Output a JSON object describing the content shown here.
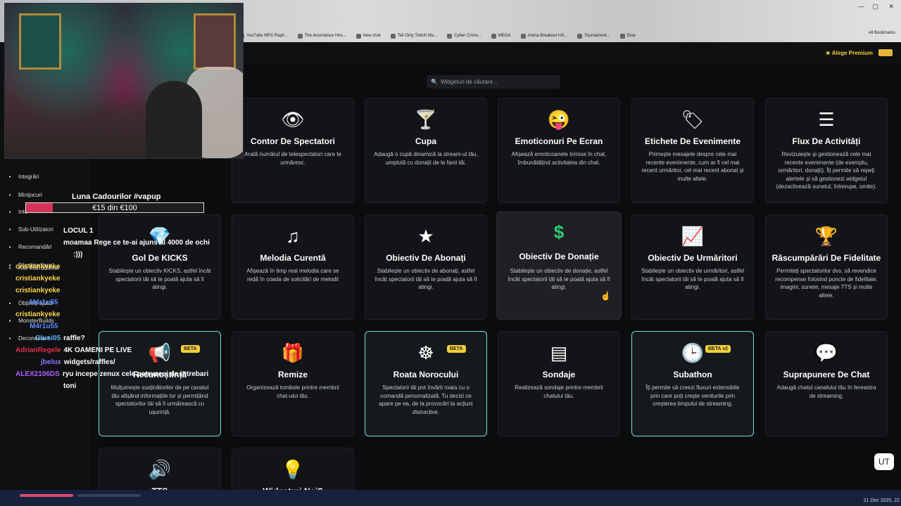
{
  "browser": {
    "bookmarks": [
      "YouTube MP3 Playli...",
      "The Anomalous Hos...",
      "New chat",
      "Tell Only Twitch Ma...",
      "Cyber Crime...",
      "MEGA",
      "Arena Breakout Infi...",
      "Tournament...",
      "Diva"
    ],
    "all_bookmarks": "All Bookmarks"
  },
  "header": {
    "premium_label": "Alege Premium"
  },
  "search": {
    "placeholder": "Widgeturi de căutare..."
  },
  "sidebar": {
    "items": [
      {
        "label": "Integrări",
        "icon": "integrations-icon"
      },
      {
        "label": "Minijocuri",
        "icon": "gamepad-icon"
      },
      {
        "label": "Inte",
        "icon": "music-icon"
      },
      {
        "label": "Sub-Utilizatori",
        "icon": "users-icon"
      },
      {
        "label": "Recomandări",
        "icon": "recommend-icon"
      },
      {
        "label": "Alte Instrumente",
        "icon": "tools-icon"
      },
      {
        "label": "Documentare",
        "icon": "docs-icon"
      },
      {
        "label": "Obțineți ajutor",
        "icon": "help-icon"
      },
      {
        "label": "MonsterBuilds",
        "icon": "monitor-icon"
      },
      {
        "label": "Deconectare",
        "icon": "logout-icon"
      }
    ]
  },
  "overlay": {
    "donation_title": "Luna Cadourilor #vapup",
    "donation_text": "€15 din €100",
    "donation_fraction": 0.15,
    "chat": [
      {
        "user": "",
        "msg": "LOCUL 1",
        "color": "#ffffff"
      },
      {
        "user": "",
        "msg": "moamaa Rege ce te-ai ajuns al 4000 de ochi",
        "color": "#ffffff"
      },
      {
        "user": "",
        "msg": ":)))",
        "color": "#ffffff"
      },
      {
        "user": "cristiankyeke",
        "msg": "",
        "color": "#ffd54a"
      },
      {
        "user": "cristiankyeke",
        "msg": "",
        "color": "#ffd54a"
      },
      {
        "user": "cristiankyeke",
        "msg": "",
        "color": "#ffd54a"
      },
      {
        "user": "M4r1u55",
        "msg": "",
        "color": "#5b8cff"
      },
      {
        "user": "cristiankyeke",
        "msg": "",
        "color": "#ffd54a"
      },
      {
        "user": "M4r1u55",
        "msg": "",
        "color": "#5b8cff"
      },
      {
        "user": "Glusi05",
        "msg": "raffle?",
        "color": "#5bb1ff"
      },
      {
        "user": "AdrianRegele",
        "msg": "4K OAMENI PE LIVE",
        "color": "#e0304a"
      },
      {
        "user": "jbelux",
        "msg": "widgets/raffles/",
        "color": "#8a78ff"
      },
      {
        "user": "ALEX2106DS",
        "msg": "ryu incepe zenux cele patruzeci de intrebari",
        "color": "#b05cff"
      },
      {
        "user": "",
        "msg": "toni",
        "color": "#ffffff"
      }
    ]
  },
  "cards": [
    {
      "title": "Contor De Spectatori",
      "desc": "Arată numărul de telespectatori care te urmăresc.",
      "icon": "eye-icon",
      "glyph": "👁"
    },
    {
      "title": "Cupa",
      "desc": "Adaugă o cupă dinamică la stream-ul tău, umplută cu donații de la fanii tăi.",
      "icon": "cocktail-icon",
      "glyph": "🍸"
    },
    {
      "title": "Emoticonuri Pe Ecran",
      "desc": "Afișează emoticoanele trimise în chat, îmbunătățind activitatea din chat.",
      "icon": "emoji-icon",
      "glyph": "😜"
    },
    {
      "title": "Etichete De Evenimente",
      "desc": "Primește mesajele despre cele mai recente evenimente, cum ar fi cel mai recent urmăritor, cel mai recent abonat și multe altele.",
      "icon": "tags-icon",
      "glyph": "🏷"
    },
    {
      "title": "Flux De Activități",
      "desc": "Revizuiește și gestionează cele mai recente evenimente (de exemplu, urmăritori, donații). Îți permite să repeți alertele și să gestionezi widgetul (dezactivează sunetul, întrerupe, omite).",
      "icon": "list-icon",
      "glyph": "☰"
    },
    {
      "title": "Gol De KICKS",
      "desc": "Stabilește un obiectiv KICKS, astfel încât spectatorii tăi să te poată ajuta să îl atingi.",
      "icon": "diamond-icon",
      "glyph": "💎"
    },
    {
      "title": "Melodia Curentă",
      "desc": "Afișează în timp real melodia care se redă în coada de solicitări de melodii",
      "icon": "music-note-icon",
      "glyph": "♫"
    },
    {
      "title": "Obiectiv De Abonați",
      "desc": "Stabilește un obiectiv de abonați, astfel încât spectatorii tăi să te poată ajuta să îl atingi.",
      "icon": "star-icon",
      "glyph": "★"
    },
    {
      "title": "Obiectiv De Donație",
      "desc": "Stabilește un obiectiv de donație, astfel încât spectatorii tăi să te poată ajuta să îl atingi.",
      "icon": "dollar-icon",
      "glyph": "$"
    },
    {
      "title": "Obiectiv De Urmăritori",
      "desc": "Stabilește un obiectiv de urmăritori, astfel încât spectatorii tăi să te poată ajuta să îl atingi.",
      "icon": "chart-icon",
      "glyph": "📈"
    },
    {
      "title": "Răscumpărări De Fidelitate",
      "desc": "Permiteți spectatorilor dvs. să revendice recompense folosind puncte de fidelitate: imagini, sunete, mesaje TTS și multe altele.",
      "icon": "trophy-icon",
      "glyph": "🏆"
    },
    {
      "title": "Recunoștință",
      "desc": "Mulțumește susținătorilor de pe canalul tău afișând informațiile lor și permițând spectatorilor tăi să îi urmărească cu ușurință.",
      "icon": "megaphone-icon",
      "glyph": "📢",
      "badge": "BETA"
    },
    {
      "title": "Remize",
      "desc": "Organizează tombole printre membrii chat-ului tău.",
      "icon": "gifts-icon",
      "glyph": "🎁"
    },
    {
      "title": "Roata Norocului",
      "desc": "Spectatorii tăi pot învârti roata cu o comandă personalizată. Tu decizi ce apare pe ea, de la provocări la acțiuni distractive.",
      "icon": "wheel-icon",
      "glyph": "☸",
      "badge": "BETA"
    },
    {
      "title": "Sondaje",
      "desc": "Realizează sondaje printre membrii chatului tău.",
      "icon": "poll-icon",
      "glyph": "▤"
    },
    {
      "title": "Subathon",
      "desc": "Îți permite să creezi fluxuri extensibile prin care poți crește veniturile prin creșterea timpului de streaming.",
      "icon": "clock-icon",
      "glyph": "🕒",
      "badge": "BETA v2"
    },
    {
      "title": "Suprapunere De Chat",
      "desc": "Adaugă chatul canalului tău în fereastra de streaming.",
      "icon": "chat-bubble-icon",
      "glyph": "💬"
    },
    {
      "title": "TTS",
      "desc": "",
      "icon": "speaker-icon",
      "glyph": "🔊"
    },
    {
      "title": "Widgeturi Noi?",
      "desc": "",
      "icon": "lightbulb-icon",
      "glyph": "💡"
    }
  ],
  "status": {
    "clock": "21 Dec 2025, 22"
  },
  "floating_button": "UT"
}
